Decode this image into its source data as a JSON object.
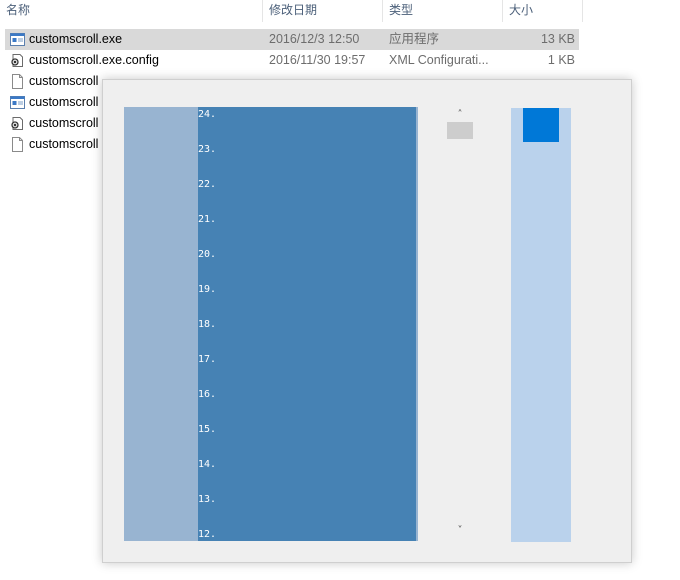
{
  "explorer": {
    "headers": {
      "name": "名称",
      "date": "修改日期",
      "type": "类型",
      "size": "大小"
    },
    "files": [
      {
        "name": "customscroll.exe",
        "date": "2016/12/3 12:50",
        "type": "应用程序",
        "size": "13 KB",
        "icon": "exe-icon",
        "selected": true
      },
      {
        "name": "customscroll.exe.config",
        "date": "2016/11/30 19:57",
        "type": "XML Configurati...",
        "size": "1 KB",
        "icon": "config-icon",
        "selected": false
      },
      {
        "name": "customscroll",
        "date": "",
        "type": "",
        "size": "",
        "icon": "file-icon",
        "selected": false
      },
      {
        "name": "customscroll",
        "date": "",
        "type": "",
        "size": "",
        "icon": "exe-icon",
        "selected": false
      },
      {
        "name": "customscroll",
        "date": "",
        "type": "",
        "size": "",
        "icon": "config-icon",
        "selected": false
      },
      {
        "name": "customscroll",
        "date": "",
        "type": "",
        "size": "",
        "icon": "file-icon",
        "selected": false
      }
    ]
  },
  "dialog": {
    "numbers": [
      "24.",
      "23.",
      "22.",
      "21.",
      "20.",
      "19.",
      "18.",
      "17.",
      "16.",
      "15.",
      "14.",
      "13.",
      "12."
    ],
    "scroll_up_glyph": "˄",
    "scroll_down_glyph": "˅",
    "colors": {
      "list_background": "#98b4d1",
      "list_inner": "#4682b4",
      "custom_track": "#bad2ec",
      "custom_thumb": "#0078d7"
    }
  }
}
